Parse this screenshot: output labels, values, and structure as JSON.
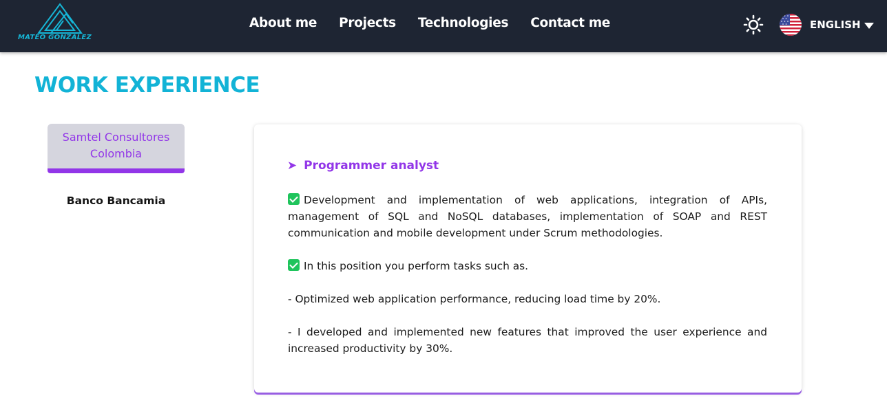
{
  "header": {
    "logo_text": "MATEO GONZALEZ",
    "nav": [
      "About me",
      "Projects",
      "Technologies",
      "Contact me"
    ],
    "theme_icon": "sun-icon",
    "language": {
      "label": "ENGLISH",
      "flag_icon": "us-flag-icon"
    }
  },
  "section": {
    "title": "WORK EXPERIENCE"
  },
  "companies": [
    {
      "name": "Samtel Consultores Colombia",
      "active": true
    },
    {
      "name": "Banco Bancamia",
      "active": false
    }
  ],
  "experience": {
    "role_arrow": "➤",
    "role": "Programmer analyst",
    "paragraphs": [
      "Development and implementation of web applications, integration of APIs, management of SQL and NoSQL databases, implementation of SOAP and REST communication and mobile development under Scrum methodologies.",
      "In this position you perform tasks such as.",
      "- Optimized web application performance, reducing load time by 20%.",
      "- I developed and implemented new features that improved the user experience and increased productivity by 30%."
    ]
  },
  "colors": {
    "navbar": "#1e2533",
    "accent_cyan": "#12b3d6",
    "accent_purple": "#9236e8",
    "check_green": "#1fc45c"
  }
}
